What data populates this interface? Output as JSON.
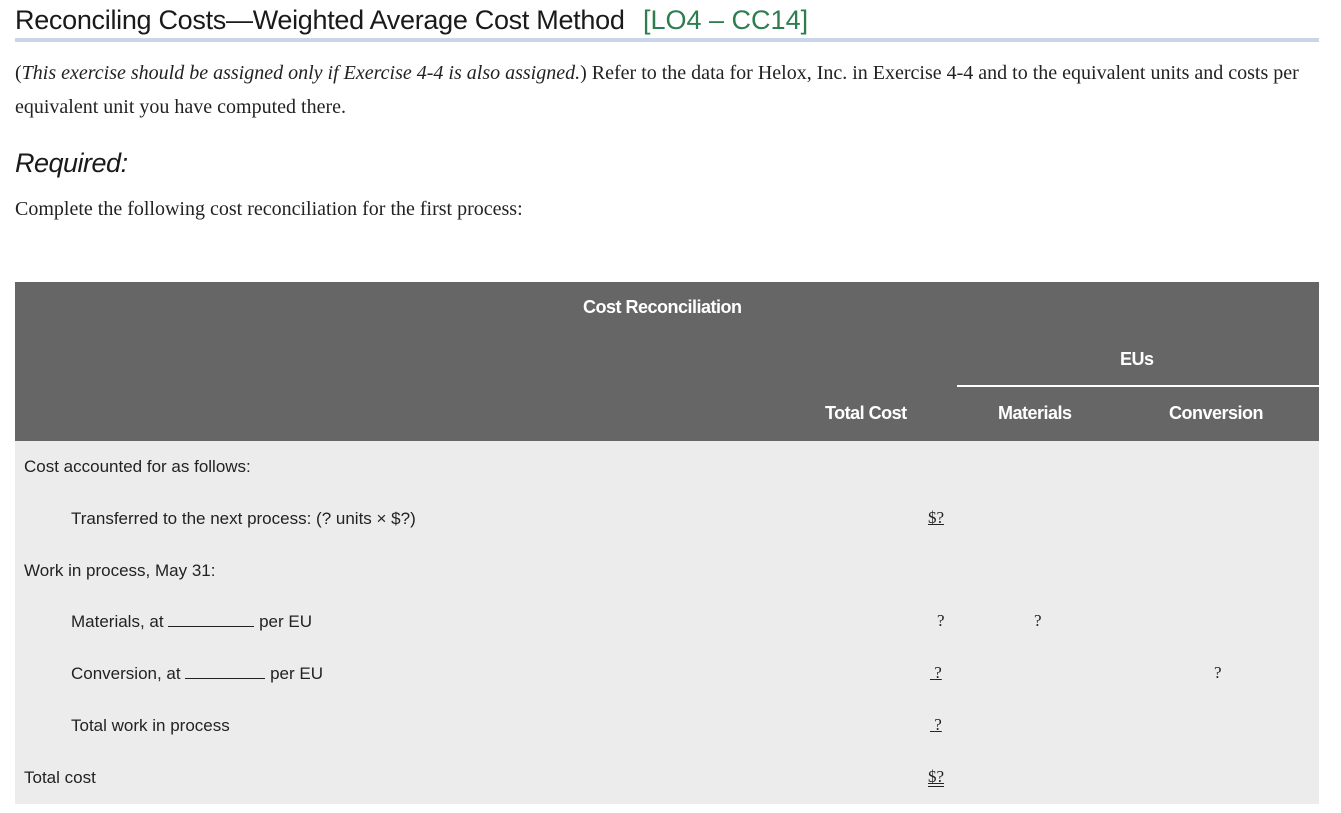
{
  "title": "Reconciling Costs—Weighted Average Cost Method",
  "title_tag": "[LO4 – CC14]",
  "intro": {
    "paren_open": "(",
    "italic": "This exercise should be assigned only if Exercise 4-4 is also assigned.",
    "paren_close": ")",
    "rest": " Refer to the data for Helox, Inc. in Exercise 4-4 and to the equivalent units and costs per equivalent unit you have computed there."
  },
  "required_label": "Required:",
  "instruction": "Complete the following cost reconciliation for the first process:",
  "table": {
    "caption": "Cost Reconciliation",
    "eus_header": "EUs",
    "col_total_cost": "Total Cost",
    "col_materials": "Materials",
    "col_conversion": "Conversion",
    "rows": {
      "accounted_label": "Cost accounted for as follows:",
      "transferred_label": "Transferred to the next process: (? units × $?)",
      "transferred_total": "$?",
      "wip_label": "Work in process, May 31:",
      "materials_prefix": "Materials, at",
      "materials_suffix": "per EU",
      "materials_total": "?",
      "materials_eu": "?",
      "conversion_prefix": "Conversion, at",
      "conversion_suffix": "per EU",
      "conversion_total": "?",
      "conversion_eu": "?",
      "total_wip_label": "Total work in process",
      "total_wip_total": "?",
      "total_cost_label": "Total cost",
      "total_cost_total": "$?"
    }
  }
}
